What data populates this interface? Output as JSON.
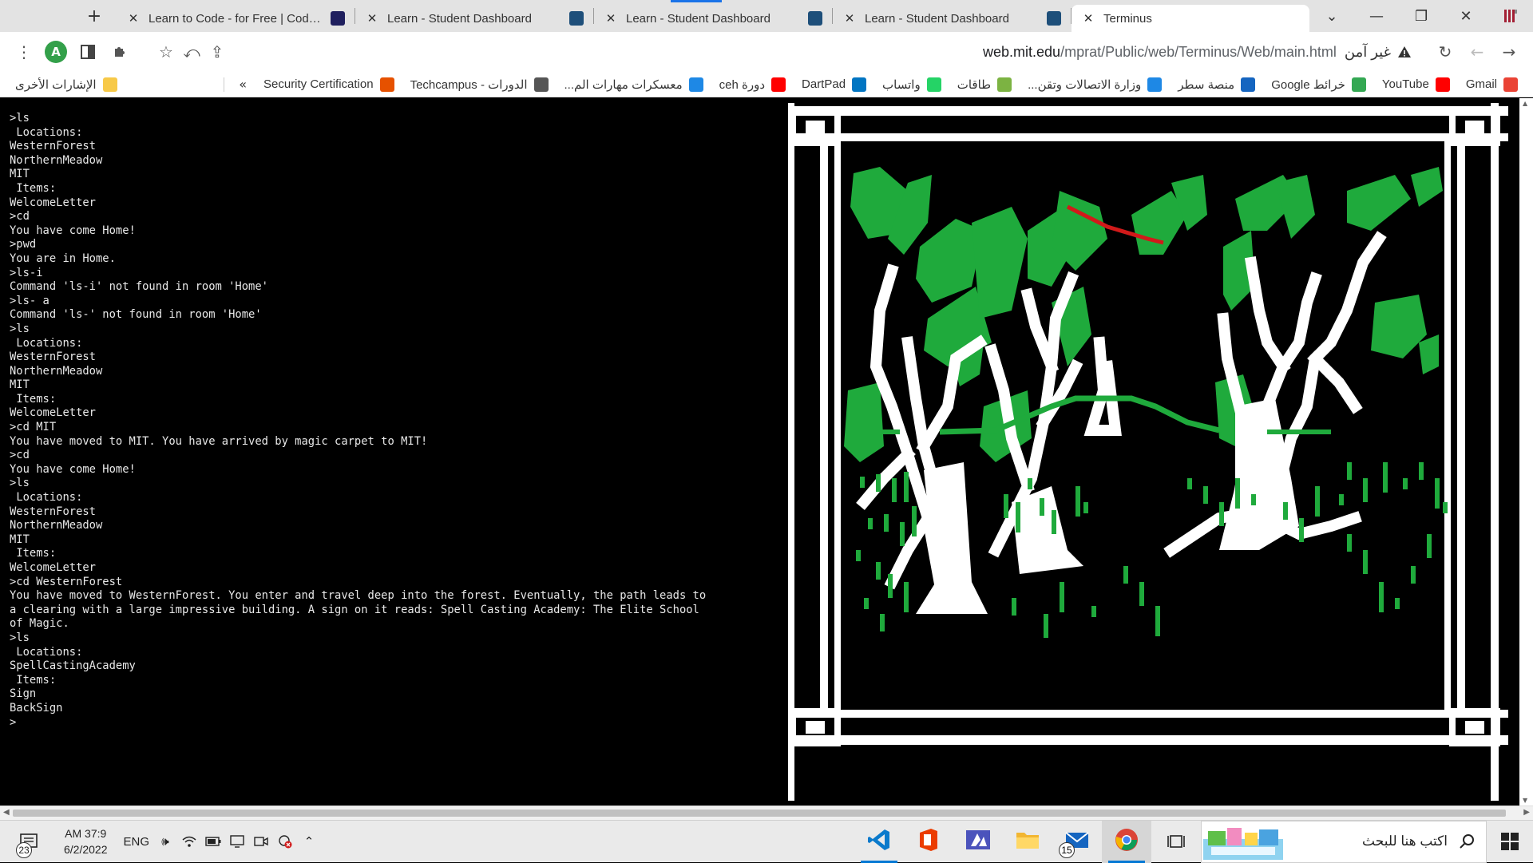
{
  "browser": {
    "tabs": [
      {
        "title": "Terminus",
        "favicon": "mit-icon",
        "active": true
      },
      {
        "title": "Learn - Student Dashboard",
        "favicon": "hyperskill-icon",
        "active": false
      },
      {
        "title": "Learn - Student Dashboard",
        "favicon": "hyperskill-icon",
        "active": false
      },
      {
        "title": "Learn - Student Dashboard",
        "favicon": "hyperskill-icon",
        "active": false
      },
      {
        "title": "Learn to Code - for Free | Codeca",
        "favicon": "codecademy-icon",
        "active": false
      }
    ],
    "new_tab_label": "+",
    "toolbar": {
      "security_label": "غير آمن",
      "url_host": "web.mit.edu",
      "url_path": "/mprat/Public/web/Terminus/Web/main.html",
      "profile_initial": "A"
    },
    "bookmarks": [
      {
        "label": "Gmail",
        "icon": "gmail-icon",
        "color": "#ea4335"
      },
      {
        "label": "YouTube",
        "icon": "youtube-icon",
        "color": "#ff0000"
      },
      {
        "label": "خرائط Google",
        "icon": "maps-icon",
        "color": "#34a853"
      },
      {
        "label": "منصة سطر",
        "icon": "satr-icon",
        "color": "#1565c0"
      },
      {
        "label": "وزارة الاتصالات وتقن...",
        "icon": "ministry-icon",
        "color": "#1e88e5"
      },
      {
        "label": "طاقات",
        "icon": "taqat-icon",
        "color": "#7cb342"
      },
      {
        "label": "واتساب",
        "icon": "whatsapp-icon",
        "color": "#25d366"
      },
      {
        "label": "DartPad",
        "icon": "dartpad-icon",
        "color": "#0175c2"
      },
      {
        "label": "دورة ceh",
        "icon": "youtube-icon",
        "color": "#ff0000"
      },
      {
        "label": "معسكرات مهارات الم...",
        "icon": "ministry-icon",
        "color": "#1e88e5"
      },
      {
        "label": "الدورات - Techcampus",
        "icon": "techcampus-icon",
        "color": "#555555"
      },
      {
        "label": "Security Certification",
        "icon": "security-icon",
        "color": "#e65100"
      }
    ],
    "other_bookmarks": "الإشارات الأخرى",
    "overflow": "»"
  },
  "terminal": {
    "lines": [
      ">ls",
      " Locations:",
      "WesternForest",
      "NorthernMeadow",
      "MIT",
      " Items:",
      "WelcomeLetter",
      ">cd",
      "You have come Home!",
      ">pwd",
      "You are in Home.",
      ">ls-i",
      "Command 'ls-i' not found in room 'Home'",
      ">ls- a",
      "Command 'ls-' not found in room 'Home'",
      ">ls",
      " Locations:",
      "WesternForest",
      "NorthernMeadow",
      "MIT",
      " Items:",
      "WelcomeLetter",
      ">cd MIT",
      "You have moved to MIT. You have arrived by magic carpet to MIT!",
      ">cd",
      "You have come Home!",
      ">ls",
      " Locations:",
      "WesternForest",
      "NorthernMeadow",
      "MIT",
      " Items:",
      "WelcomeLetter",
      ">cd WesternForest",
      "You have moved to WesternForest. You enter and travel deep into the forest. Eventually, the path leads to",
      "a clearing with a large impressive building. A sign on it reads: Spell Casting Academy: The Elite School",
      "of Magic.",
      ">ls",
      " Locations:",
      "SpellCastingAcademy",
      " Items:",
      "Sign",
      "BackSign",
      ">"
    ]
  },
  "art": {
    "subject": "pixel-art-forest",
    "tree_green": "#1faa3c",
    "ground_green": "#1faa3c",
    "bark": "#ffffff",
    "branch_red": "#d11a1a",
    "frame": "#ffffff"
  },
  "taskbar": {
    "search_placeholder": "اكتب هنا للبحث",
    "apps": [
      {
        "name": "chrome-icon",
        "running": true,
        "active": true
      },
      {
        "name": "mail-icon",
        "running": false,
        "badge": "15"
      },
      {
        "name": "file-explorer-icon",
        "running": false
      },
      {
        "name": "azure-icon",
        "running": false
      },
      {
        "name": "office-icon",
        "running": false
      },
      {
        "name": "vscode-icon",
        "running": true
      }
    ],
    "language": "ENG",
    "clock_time": "AM 37:9",
    "clock_date": "6/2/2022",
    "notification_count": "23"
  }
}
